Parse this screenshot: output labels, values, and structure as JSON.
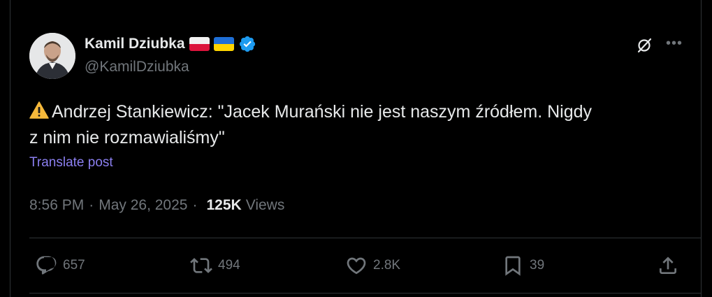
{
  "author": {
    "name": "Kamil Dziubka",
    "handle": "@KamilDziubka",
    "flags": [
      "pl-flag",
      "ua-flag"
    ],
    "verified": true
  },
  "post": {
    "text_line1": "Andrzej Stankiewicz: \"Jacek Murański nie jest naszym źródłem. Nigdy",
    "text_line2": "z nim nie rozmawialiśmy\"",
    "translate_label": "Translate post"
  },
  "meta": {
    "time": "8:56 PM",
    "separator": "·",
    "date": "May 26, 2025",
    "views_count": "125K",
    "views_label": "Views"
  },
  "actions": {
    "replies": "657",
    "reposts": "494",
    "likes": "2.8K",
    "bookmarks": "39"
  },
  "colors": {
    "background": "#000000",
    "text": "#e7e9ea",
    "muted": "#71767b",
    "link": "#8b7ff0",
    "verified": "#1d9bf0"
  }
}
